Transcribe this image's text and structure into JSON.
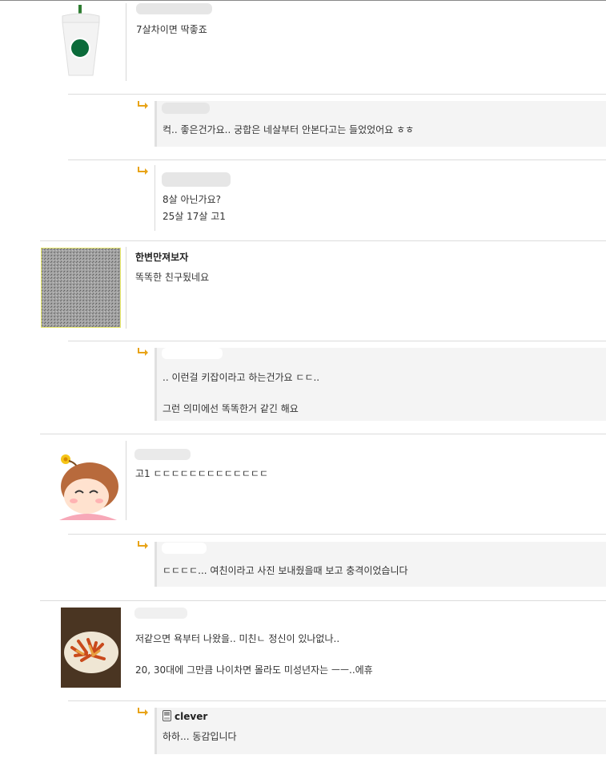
{
  "comments": [
    {
      "text": "7살차이면 딱좋죠",
      "avatar": "starbucks-cup-icon"
    },
    {
      "reply": true,
      "text": "컥.. 좋은건가요.. 궁합은 네살부터 안본다고는 들었었어요 ㅎㅎ"
    },
    {
      "reply": true,
      "lines": [
        "8살 아닌가요?",
        "25살 17살 고1"
      ]
    },
    {
      "name": "한변만져보자",
      "text": "똑똑한 친구됬네요",
      "avatar": "noise-pattern-avatar"
    },
    {
      "reply": true,
      "lines": [
        ".. 이런걸 키잡이라고 하는건가요 ㄷㄷ..",
        "그런 의미에선 똑똑한거 같긴 해요"
      ]
    },
    {
      "text": "고1 ㄷㄷㄷㄷㄷㄷㄷㄷㄷㄷㄷㄷㄷ",
      "avatar": "cartoon-girl-avatar"
    },
    {
      "reply": true,
      "text": "ㄷㄷㄷㄷ... 여친이라고 사진 보내줬을때 보고 충격이었습니다"
    },
    {
      "lines": [
        "저같으면 욕부터 나왔을.. 미친ㄴ 정신이 있나없나..",
        "20, 30대에 그만큼 나이차면 몰라도 미성년자는 ㅡㅡ..에휴"
      ],
      "avatar": "food-photo-avatar"
    },
    {
      "reply": true,
      "name": "clever",
      "text": "하하... 동감입니다",
      "name_icon": "mobile-phone-icon"
    }
  ],
  "colors": {
    "reply_bg": "#f4f4f4",
    "arrow": "#e8a317",
    "separator": "#dcdcdc",
    "avatar_border": "#e8e86a"
  }
}
